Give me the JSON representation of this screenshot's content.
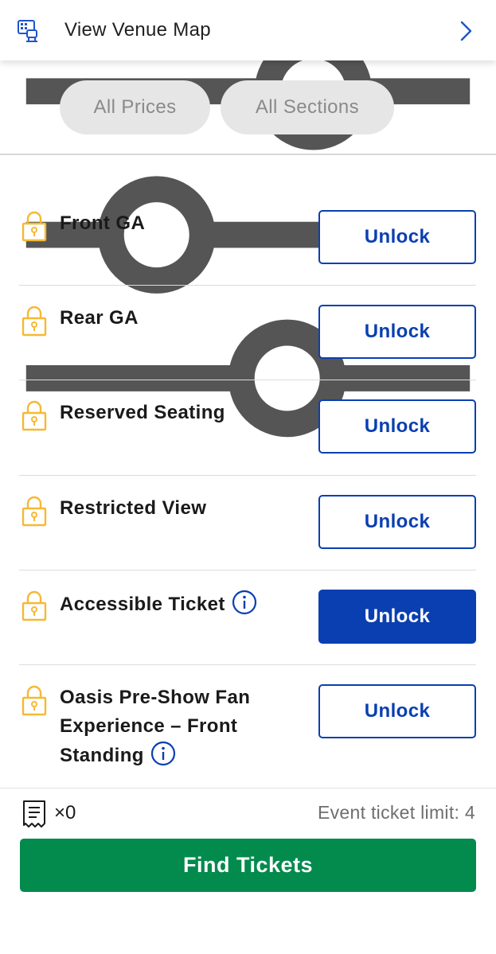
{
  "venue_bar": {
    "label": "View Venue Map",
    "icon": "seat-map-icon",
    "chevron": "chevron-right-icon"
  },
  "filters": {
    "icon": "sliders-icon",
    "prices_label": "All Prices",
    "sections_label": "All Sections"
  },
  "tickets": [
    {
      "name": "Front GA",
      "button": "Unlock",
      "info": false,
      "selected": false
    },
    {
      "name": "Rear GA",
      "button": "Unlock",
      "info": false,
      "selected": false
    },
    {
      "name": "Reserved Seating",
      "button": "Unlock",
      "info": false,
      "selected": false
    },
    {
      "name": "Restricted View",
      "button": "Unlock",
      "info": false,
      "selected": false
    },
    {
      "name": "Accessible Ticket",
      "button": "Unlock",
      "info": true,
      "selected": true
    },
    {
      "name_lines": [
        "Oasis Pre-Show Fan",
        "Experience – Front",
        "Standing"
      ],
      "button": "Unlock",
      "info": true,
      "selected": false
    }
  ],
  "footer": {
    "ticket_count": "×0",
    "limit": "Event ticket limit: 4",
    "find_button": "Find Tickets"
  },
  "colors": {
    "brand_blue": "#0a3fb1",
    "lock_yellow": "#f5b933",
    "find_green": "#038a4d",
    "pill_grey": "#e6e6e6"
  }
}
